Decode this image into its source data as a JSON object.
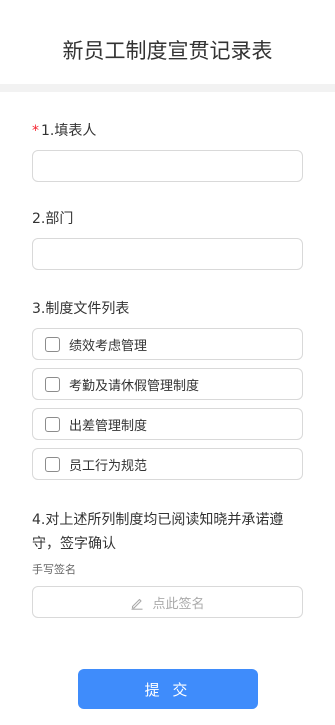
{
  "form": {
    "title": "新员工制度宣贯记录表",
    "q1": {
      "required_mark": "*",
      "label": "1.填表人",
      "value": ""
    },
    "q2": {
      "label": "2.部门",
      "value": ""
    },
    "q3": {
      "label": "3.制度文件列表",
      "options": [
        {
          "label": "绩效考虑管理",
          "checked": false
        },
        {
          "label": "考勤及请休假管理制度",
          "checked": false
        },
        {
          "label": "出差管理制度",
          "checked": false
        },
        {
          "label": "员工行为规范",
          "checked": false
        }
      ]
    },
    "q4": {
      "label": "4.对上述所列制度均已阅读知晓并承诺遵守，签字确认",
      "signature_caption": "手写签名",
      "signature_placeholder": "点此签名"
    },
    "submit_label": "提 交"
  },
  "colors": {
    "accent": "#3f8cfb",
    "required": "#f5222d",
    "border": "#d9d9d9",
    "divider": "#f2f2f2"
  },
  "icons": {
    "signature": "pen-icon"
  }
}
